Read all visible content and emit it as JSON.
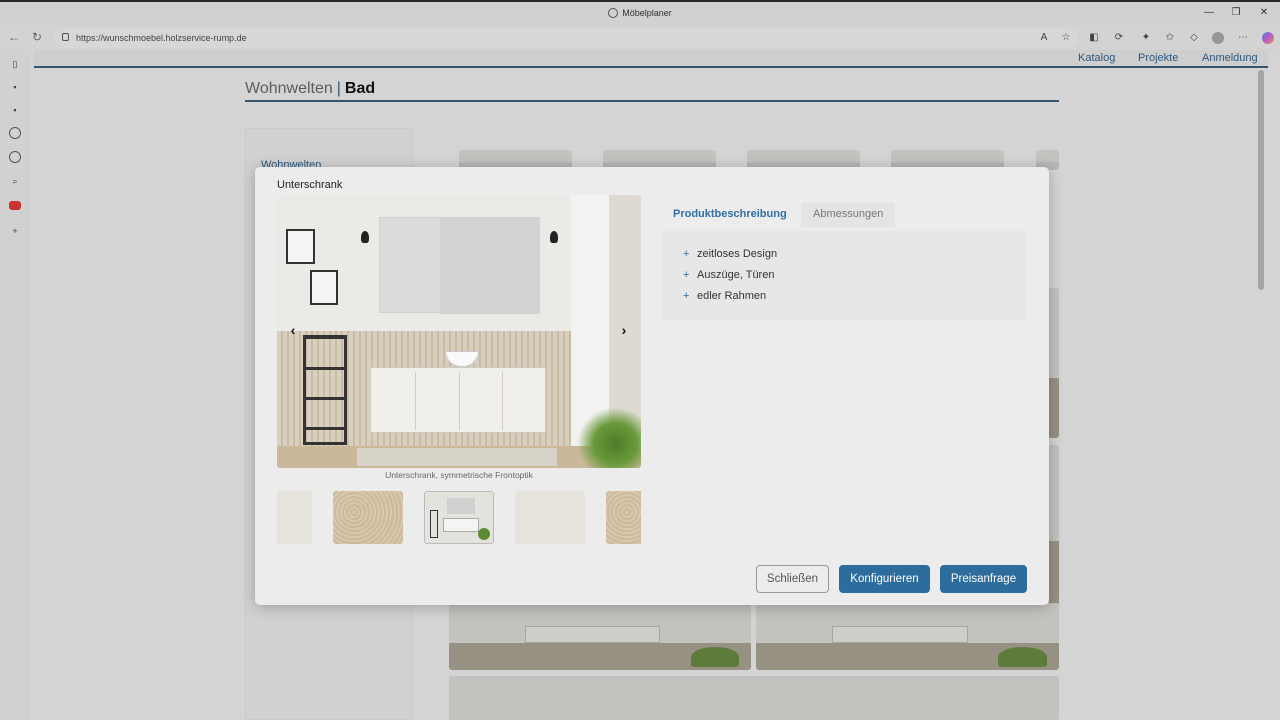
{
  "browser": {
    "title": "Möbelplaner",
    "url": "https://wunschmoebel.holzservice-rump.de"
  },
  "site": {
    "nav": [
      "Katalog",
      "Projekte",
      "Anmeldung"
    ],
    "breadcrumb": {
      "section": "Wohnwelten",
      "separator": "|",
      "current": "Bad"
    },
    "sidebar_title": "Wohnwelten"
  },
  "modal": {
    "title": "Unterschrank",
    "caption": "Unterschrank, symmetrische Frontoptik",
    "tabs": [
      "Produktbeschreibung",
      "Abmessungen"
    ],
    "features": [
      "zeitloses Design",
      "Auszüge, Türen",
      "edler Rahmen"
    ],
    "buttons": {
      "close": "Schließen",
      "configure": "Konfigurieren",
      "quote": "Preisanfrage"
    }
  },
  "colors": {
    "primary": "#2d6d9e",
    "link": "#2f5a7f",
    "accent_text": "#2f6fa5"
  }
}
